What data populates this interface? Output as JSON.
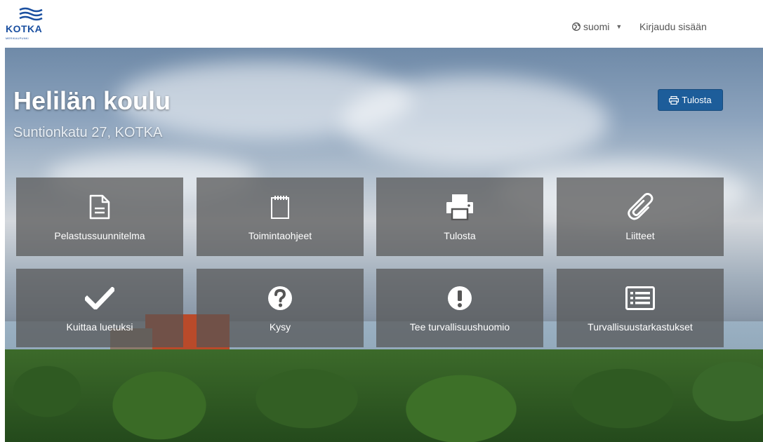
{
  "header": {
    "logo_text": "KOTKA",
    "logo_subtitle": "MERIKAUPUNKI",
    "language": "suomi",
    "login": "Kirjaudu sisään"
  },
  "hero": {
    "title": "Helilän koulu",
    "address": "Suntionkatu 27, KOTKA",
    "print_button": "Tulosta"
  },
  "tiles": [
    {
      "label": "Pelastussuunnitelma",
      "icon": "document-icon"
    },
    {
      "label": "Toimintaohjeet",
      "icon": "notepad-icon"
    },
    {
      "label": "Tulosta",
      "icon": "printer-icon"
    },
    {
      "label": "Liitteet",
      "icon": "paperclip-icon"
    },
    {
      "label": "Kuittaa luetuksi",
      "icon": "checkmark-icon"
    },
    {
      "label": "Kysy",
      "icon": "question-circle-icon"
    },
    {
      "label": "Tee turvallisuushuomio",
      "icon": "exclamation-circle-icon"
    },
    {
      "label": "Turvallisuustarkastukset",
      "icon": "list-icon"
    }
  ],
  "colors": {
    "primary_button": "#1d5d9a",
    "tile_background": "#555555",
    "logo_blue": "#1a4fa0"
  }
}
